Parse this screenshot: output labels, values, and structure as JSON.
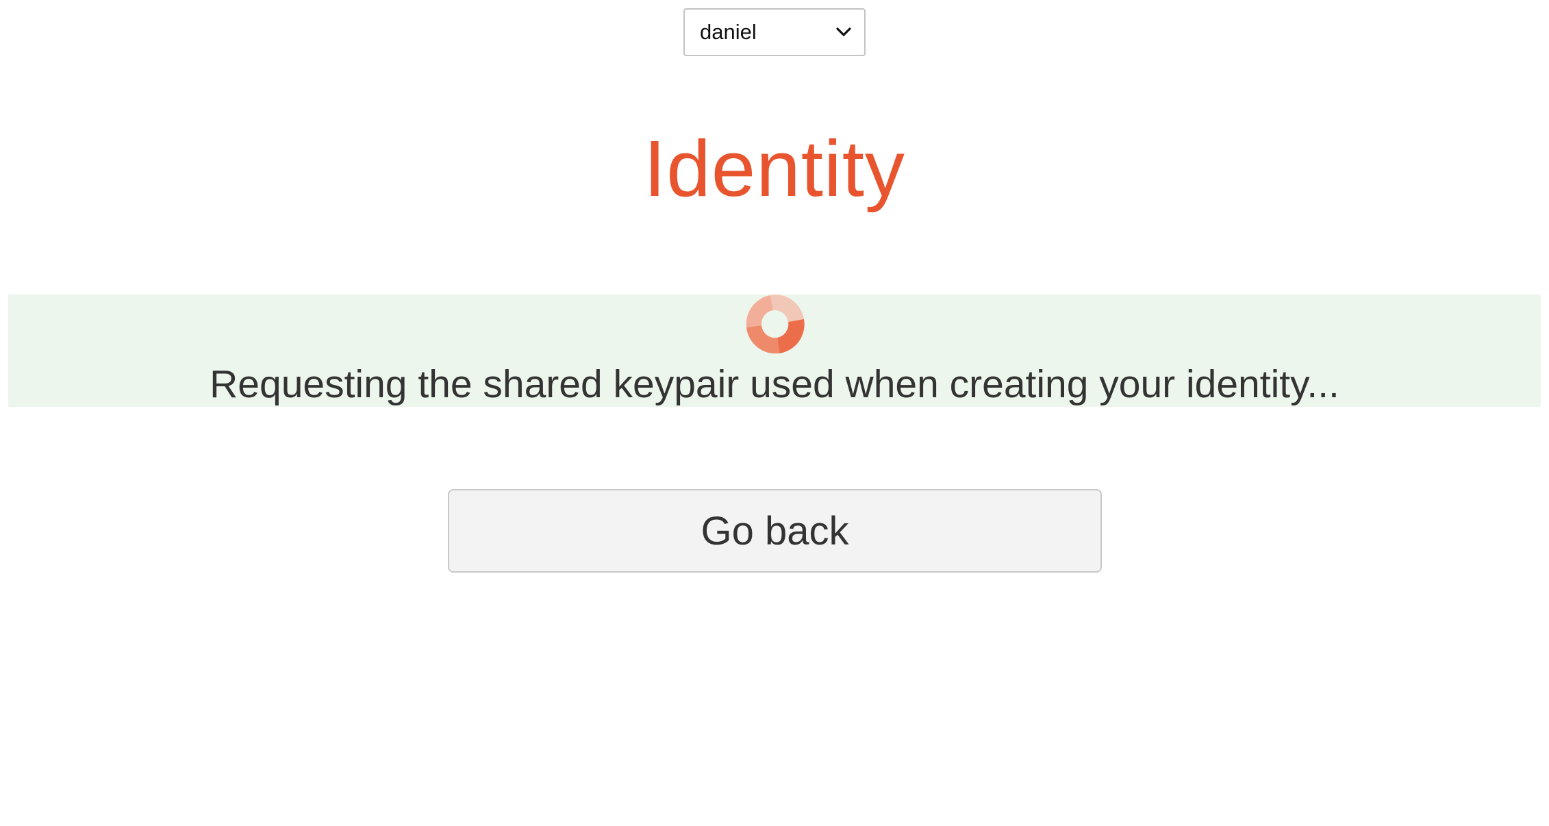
{
  "user_select": {
    "value": "daniel",
    "icon": "chevron-down-icon"
  },
  "page": {
    "title": "Identity"
  },
  "status": {
    "message": "Requesting the shared keypair used when creating your identity...",
    "spinner_icon": "loading-spinner-icon",
    "background_color": "#edf6ec"
  },
  "actions": {
    "go_back_label": "Go back"
  },
  "colors": {
    "accent": "#e8542e",
    "text": "#333333"
  }
}
